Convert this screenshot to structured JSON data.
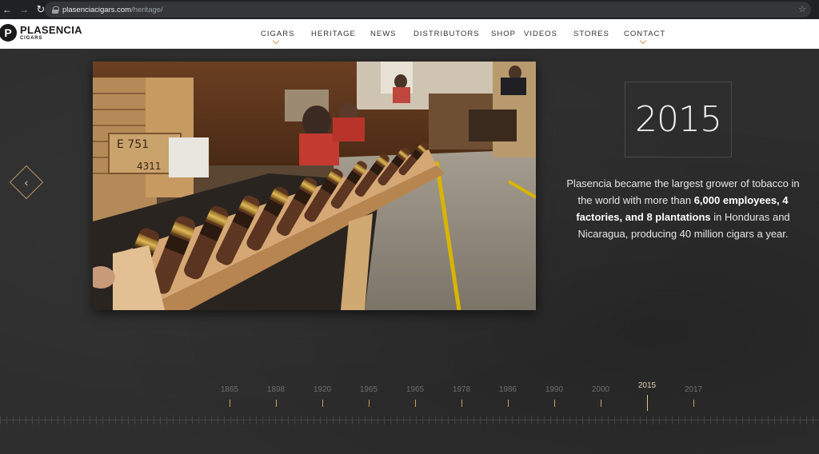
{
  "browser": {
    "url_host": "plasenciacigars.com",
    "url_path": "/heritage/"
  },
  "brand": {
    "name": "PLASENCIA",
    "sub": "CIGARS",
    "mark": "P"
  },
  "nav": [
    {
      "label": "CIGARS",
      "caret": true
    },
    {
      "label": "HERITAGE",
      "caret": false
    },
    {
      "label": "NEWS",
      "caret": false
    },
    {
      "label": "DISTRIBUTORS",
      "caret": false
    },
    {
      "label": "SHOP",
      "caret": false
    },
    {
      "label": "VIDEOS",
      "caret": false
    },
    {
      "label": "STORES",
      "caret": false
    },
    {
      "label": "CONTACT",
      "caret": true
    }
  ],
  "slide": {
    "year": "2015",
    "desc_intro": "Plasencia became the largest grower of tobacco in the world with more than ",
    "desc_bold": "6,000 employees, 4 factories, and 8 plantations",
    "desc_outro": " in Honduras and Nicaragua, producing 40 million cigars a year."
  },
  "timeline": {
    "years": [
      "1865",
      "1898",
      "1920",
      "1965",
      "1965",
      "1978",
      "1986",
      "1990",
      "2000",
      "2015",
      "2017"
    ],
    "active": "2015"
  },
  "colors": {
    "accent": "#c9a15a",
    "background": "#2e2e2e"
  }
}
